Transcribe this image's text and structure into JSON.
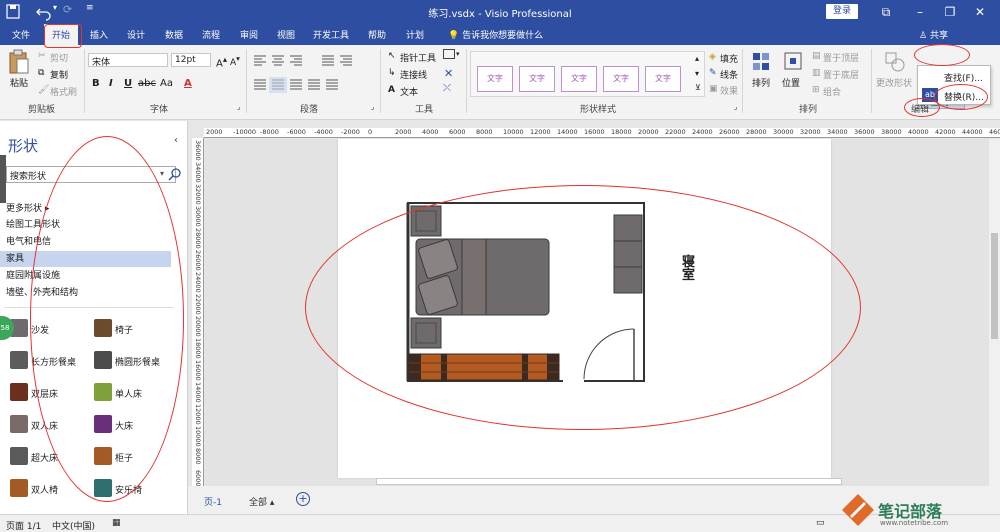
{
  "app": {
    "title": "练习.vsdx - Visio Professional",
    "login": "登录",
    "share": "共享"
  },
  "tabs": [
    {
      "label": "文件"
    },
    {
      "label": "开始"
    },
    {
      "label": "插入"
    },
    {
      "label": "设计"
    },
    {
      "label": "数据"
    },
    {
      "label": "流程"
    },
    {
      "label": "审阅"
    },
    {
      "label": "视图"
    },
    {
      "label": "开发工具"
    },
    {
      "label": "帮助"
    },
    {
      "label": "计划"
    }
  ],
  "tell_me": "告诉我你想要做什么",
  "ribbon": {
    "clipboard": {
      "paste": "粘贴",
      "cut": "剪切",
      "copy": "复制",
      "format_painter": "格式刷",
      "label": "剪贴板"
    },
    "font": {
      "name": "宋体",
      "size": "12pt",
      "label": "字体",
      "bold": "B",
      "italic": "I",
      "underline": "U",
      "strike": "abc",
      "case": "Aa",
      "color": "A"
    },
    "paragraph": {
      "label": "段落"
    },
    "tools": {
      "pointer": "指针工具",
      "connector": "连接线",
      "text": "文本",
      "label": "工具"
    },
    "shape_styles": {
      "tiles": [
        "文字",
        "文字",
        "文字",
        "文字",
        "文字"
      ],
      "fill": "填充",
      "line": "线条",
      "effect": "效果",
      "label": "形状样式"
    },
    "arrange": {
      "arrange": "排列",
      "position": "位置",
      "bring_front": "置于顶层",
      "send_back": "置于底层",
      "group": "组合",
      "label": "排列"
    },
    "editing": {
      "change_shape": "更改形状",
      "find": "查找",
      "label": "编辑"
    },
    "find_menu": {
      "find_item": "查找(F)...",
      "replace_item": "替换(R)..."
    }
  },
  "shapes_panel": {
    "title": "形状",
    "search_placeholder": "搜索形状",
    "categories": [
      {
        "label": "更多形状",
        "selected": false
      },
      {
        "label": "绘图工具形状",
        "selected": false
      },
      {
        "label": "电气和电信",
        "selected": false
      },
      {
        "label": "家具",
        "selected": true
      },
      {
        "label": "庭园附属设施",
        "selected": false
      },
      {
        "label": "墙壁、外壳和结构",
        "selected": false
      }
    ],
    "stencils": [
      {
        "label": "沙发",
        "color": "#6f6a6c"
      },
      {
        "label": "椅子",
        "color": "#6b4a2e"
      },
      {
        "label": "长方形餐桌",
        "color": "#5c5c5c"
      },
      {
        "label": "椭圆形餐桌",
        "color": "#4b4b4b"
      },
      {
        "label": "双层床",
        "color": "#6a2f1f"
      },
      {
        "label": "单人床",
        "color": "#7fa03a"
      },
      {
        "label": "双人床",
        "color": "#7a6a6a"
      },
      {
        "label": "大床",
        "color": "#6a2e7a"
      },
      {
        "label": "超大床",
        "color": "#5a5a5a"
      },
      {
        "label": "柜子",
        "color": "#a35a25"
      },
      {
        "label": "双人椅",
        "color": "#a35a25"
      },
      {
        "label": "安乐椅",
        "color": "#2f6f6f"
      }
    ]
  },
  "ruler": {
    "h_labels": [
      "2000",
      "-10000",
      "-8000",
      "-6000",
      "-4000",
      "-2000",
      "0",
      "2000",
      "4000",
      "6000",
      "8000",
      "10000",
      "12000",
      "14000",
      "16000",
      "18000",
      "20000",
      "22000",
      "24000",
      "26000",
      "28000",
      "30000",
      "32000",
      "34000",
      "36000",
      "38000",
      "40000",
      "42000",
      "44000",
      "46000"
    ],
    "v_labels": [
      "36000",
      "34000",
      "32000",
      "30000",
      "28000",
      "26000",
      "24000",
      "22000",
      "20000",
      "18000",
      "16000",
      "14000",
      "12000",
      "10000",
      "8000",
      "6000"
    ]
  },
  "drawing": {
    "room_label": "寝室"
  },
  "page_tabs": {
    "page1": "页-1",
    "all": "全部"
  },
  "status": {
    "pages": "页面 1/1",
    "language": "中文(中国)"
  },
  "watermark": {
    "text": "笔记部落",
    "sub": "www.notetribe.com"
  },
  "colors": {
    "accent": "#2e4ea1",
    "annotation": "#e2342d",
    "furniture": "#6f6a6c",
    "cabinet": "#b35a22"
  }
}
